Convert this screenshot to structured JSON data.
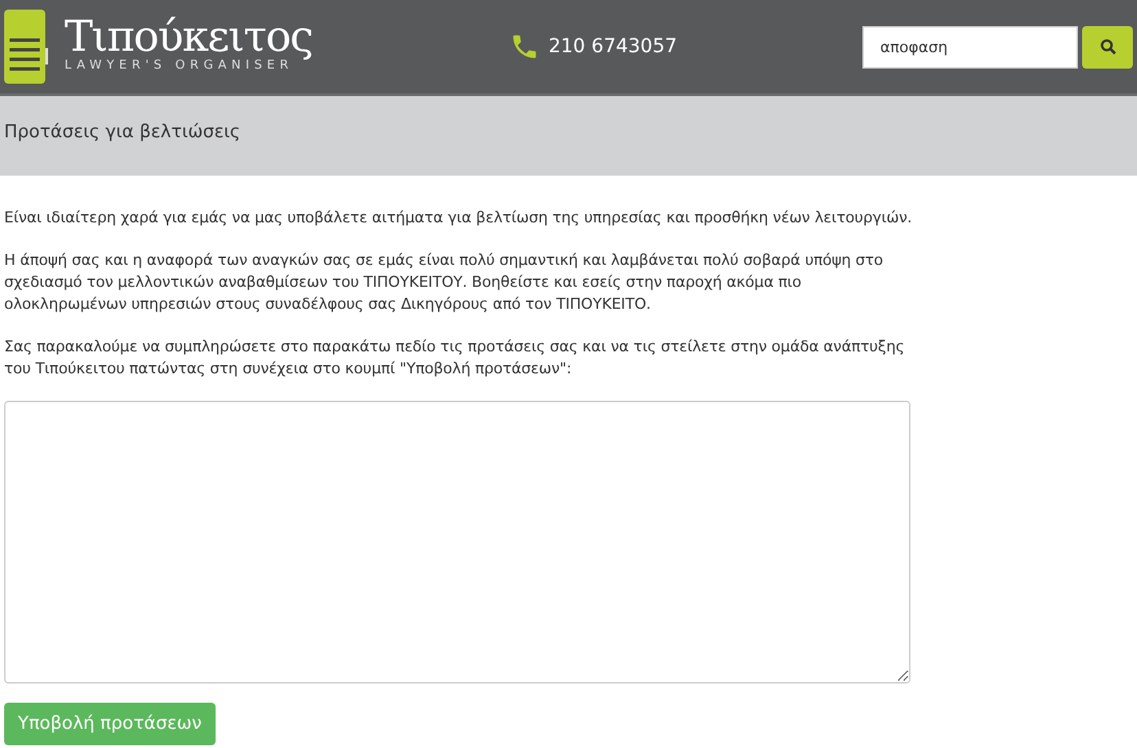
{
  "header": {
    "logo": {
      "name": "Τιπούκειτος",
      "tagline": "LAWYER'S ORGANISER"
    },
    "phone": "210 6743057",
    "search": {
      "value": "αποφαση"
    }
  },
  "page_title": "Προτάσεις για βελτιώσεις",
  "paragraphs": [
    "Είναι ιδιαίτερη χαρά για εμάς να μας υποβάλετε αιτήματα για βελτίωση της υπηρεσίας και προσθήκη νέων λειτουργιών.",
    "Η άποψή σας και η αναφορά των αναγκών σας σε εμάς είναι πολύ σημαντική και λαμβάνεται πολύ σοβαρά υπόψη στο σχεδιασμό τον μελλοντικών αναβαθμίσεων του ΤΙΠΟΥΚΕΙΤΟΥ. Βοηθείστε και εσείς στην παροχή ακόμα πιο ολοκληρωμένων υπηρεσιών στους συναδέλφους σας Δικηγόρους από τον ΤΙΠΟΥΚΕΙΤΟ.",
    "Σας παρακαλούμε να συμπληρώσετε στο παρακάτω πεδίο τις προτάσεις σας και να τις στείλετε στην ομάδα ανάπτυξης του Τιπούκειτου πατώντας στη συνέχεια στο κουμπί \"Υποβολή προτάσεων\":"
  ],
  "submit_button": "Υποβολή προτάσεων"
}
